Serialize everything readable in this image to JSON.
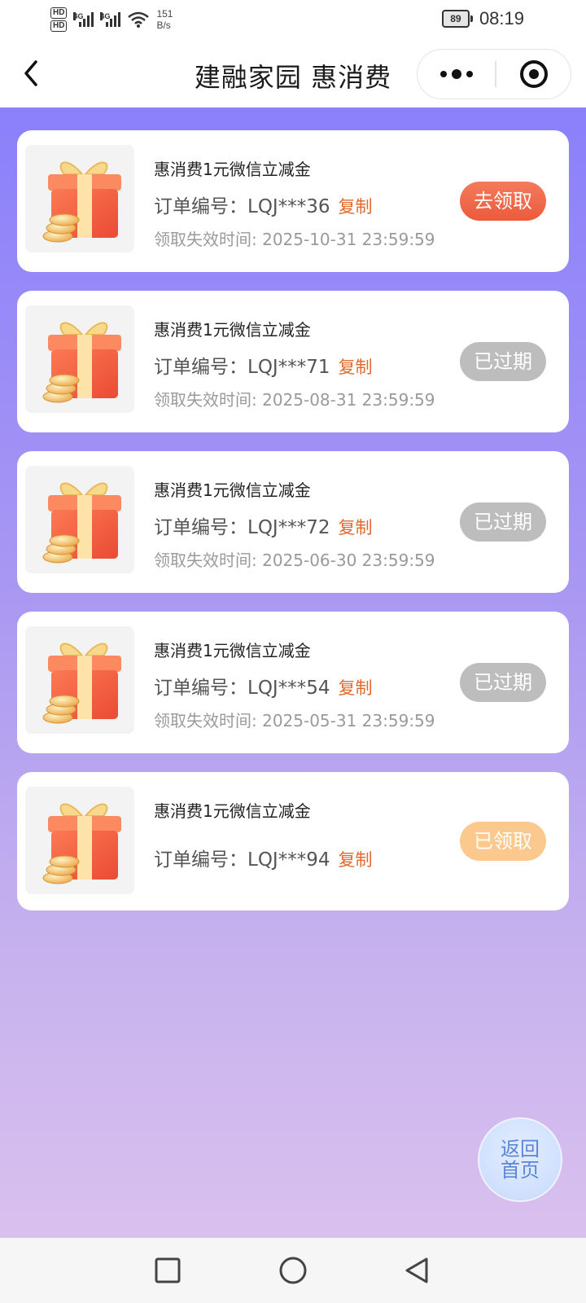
{
  "status_bar": {
    "hd1": "HD",
    "hd2": "HD",
    "net1": "4G",
    "net2": "4G",
    "speed_value": "151",
    "speed_unit": "B/s",
    "battery": "89",
    "time": "08:19"
  },
  "nav": {
    "title": "建融家园 惠消费"
  },
  "cards": [
    {
      "title": "惠消费1元微信立减金",
      "order_label": "订单编号：",
      "order_no": "LQJ***36",
      "copy_label": "复制",
      "expire": "领取失效时间: 2025-10-31 23:59:59",
      "action": "去领取",
      "status": "claim"
    },
    {
      "title": "惠消费1元微信立减金",
      "order_label": "订单编号：",
      "order_no": "LQJ***71",
      "copy_label": "复制",
      "expire": "领取失效时间: 2025-08-31 23:59:59",
      "action": "已过期",
      "status": "expired"
    },
    {
      "title": "惠消费1元微信立减金",
      "order_label": "订单编号：",
      "order_no": "LQJ***72",
      "copy_label": "复制",
      "expire": "领取失效时间: 2025-06-30 23:59:59",
      "action": "已过期",
      "status": "expired"
    },
    {
      "title": "惠消费1元微信立减金",
      "order_label": "订单编号：",
      "order_no": "LQJ***54",
      "copy_label": "复制",
      "expire": "领取失效时间: 2025-05-31 23:59:59",
      "action": "已过期",
      "status": "expired"
    },
    {
      "title": "惠消费1元微信立减金",
      "order_label": "订单编号：",
      "order_no": "LQJ***94",
      "copy_label": "复制",
      "action": "已领取",
      "status": "claimed"
    }
  ],
  "home_button": {
    "line1": "返回",
    "line2": "首页"
  },
  "colors": {
    "accent_orange": "#e0692e",
    "claim_button": "#ec5a3b",
    "expired_button": "#bdbdbd",
    "claimed_button": "#fbc98d",
    "background_top": "#8b80fb",
    "background_bottom": "#d9c0ee"
  },
  "icons": {
    "back": "chevron-left-icon",
    "more": "more-dots-icon",
    "close": "target-close-icon",
    "gift": "gift-box-icon",
    "nav_recent": "square-icon",
    "nav_home": "circle-icon",
    "nav_back": "triangle-back-icon"
  }
}
